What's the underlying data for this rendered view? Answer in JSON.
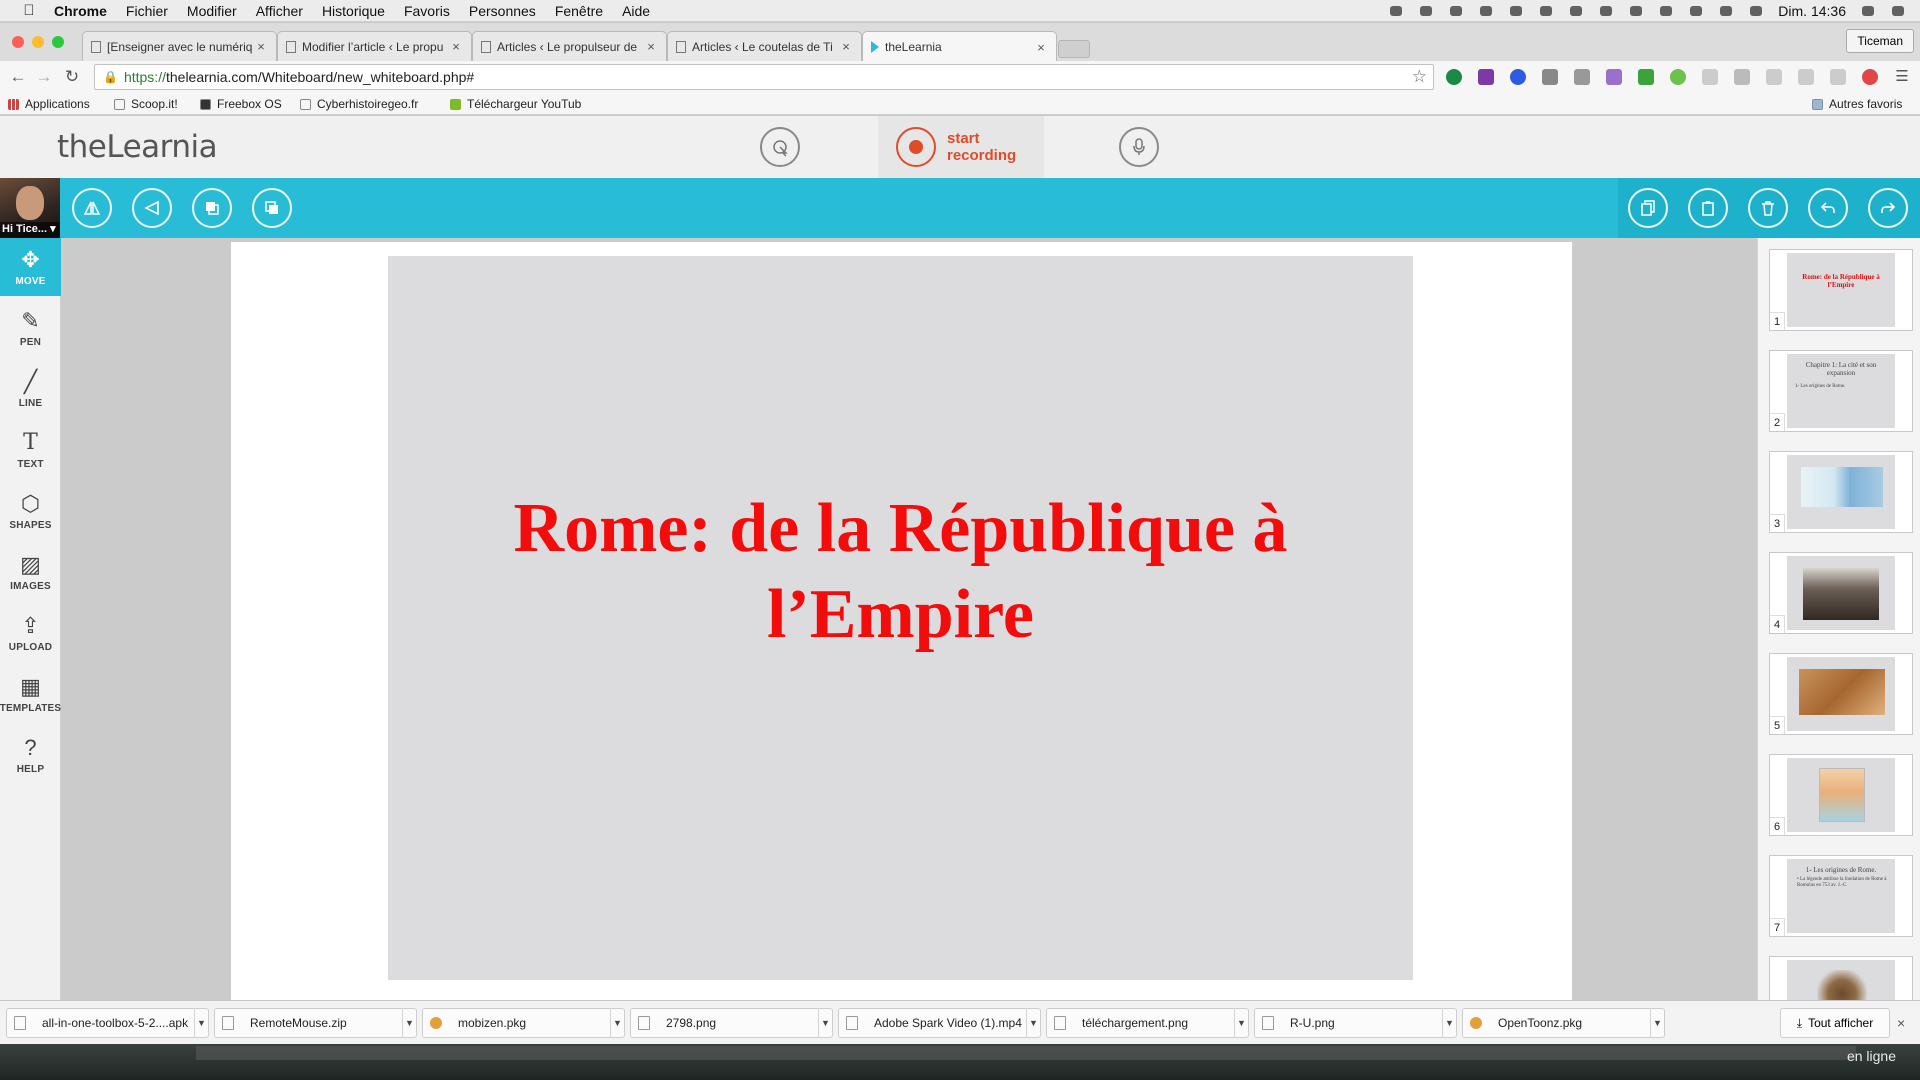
{
  "menubar": {
    "app": "Chrome",
    "items": [
      "Fichier",
      "Modifier",
      "Afficher",
      "Historique",
      "Favoris",
      "Personnes",
      "Fenêtre",
      "Aide"
    ],
    "clock": "Dim. 14:36"
  },
  "browser": {
    "tabs": [
      {
        "label": "[Enseigner avec le numériq"
      },
      {
        "label": "Modifier l’article ‹ Le propu"
      },
      {
        "label": "Articles ‹ Le propulseur de"
      },
      {
        "label": "Articles ‹ Le coutelas de Ti"
      },
      {
        "label": "theLearnia"
      }
    ],
    "profile": "Ticeman",
    "url_scheme": "https://",
    "url_rest": "thelearnia.com/Whiteboard/new_whiteboard.php#",
    "bookmarks": [
      "Applications",
      "Scoop.it!",
      "Freebox OS",
      "Cyberhistoiregeo.fr",
      "Téléchargeur YouTub"
    ],
    "other_bookmarks": "Autres favoris"
  },
  "app": {
    "logo": "theLearnia",
    "record_line1": "start",
    "record_line2": "recording",
    "user_name": "Hi Tice... ▾",
    "tools": [
      {
        "label": "MOVE",
        "icon": "move-icon"
      },
      {
        "label": "PEN",
        "icon": "pen-icon"
      },
      {
        "label": "LINE",
        "icon": "line-icon"
      },
      {
        "label": "TEXT",
        "icon": "text-icon"
      },
      {
        "label": "SHAPES",
        "icon": "shapes-icon"
      },
      {
        "label": "IMAGES",
        "icon": "images-icon"
      },
      {
        "label": "UPLOAD",
        "icon": "upload-icon"
      },
      {
        "label": "TEMPLATES",
        "icon": "templates-icon"
      },
      {
        "label": "HELP",
        "icon": "help-icon"
      }
    ]
  },
  "slide": {
    "title_line1": "Rome: de la République à",
    "title_line2": "l’Empire"
  },
  "thumbnails": [
    {
      "num": "1",
      "title": "Rome: de la République à l’Empire"
    },
    {
      "num": "2",
      "title": "Chapitre 1: La cité et son expansion",
      "sub": "1- Les origines de Rome."
    },
    {
      "num": "3"
    },
    {
      "num": "4"
    },
    {
      "num": "5"
    },
    {
      "num": "6"
    },
    {
      "num": "7",
      "title": "1- Les origines de Rome.",
      "sub": "• La légende attribue la fondation de Rome à Romulus en 753 av. J.-C."
    },
    {
      "num": ""
    }
  ],
  "downloads": {
    "items": [
      "all-in-one-toolbox-5-2....apk",
      "RemoteMouse.zip",
      "mobizen.pkg",
      "2798.png",
      "Adobe Spark Video (1).mp4",
      "téléchargement.png",
      "R-U.png",
      "OpenToonz.pkg"
    ],
    "show_all": "Tout afficher"
  },
  "desktop": {
    "status": "en ligne"
  },
  "colors": {
    "accent": "#28bcd6",
    "record": "#e04b2a",
    "slide_title": "#f20c0c"
  }
}
